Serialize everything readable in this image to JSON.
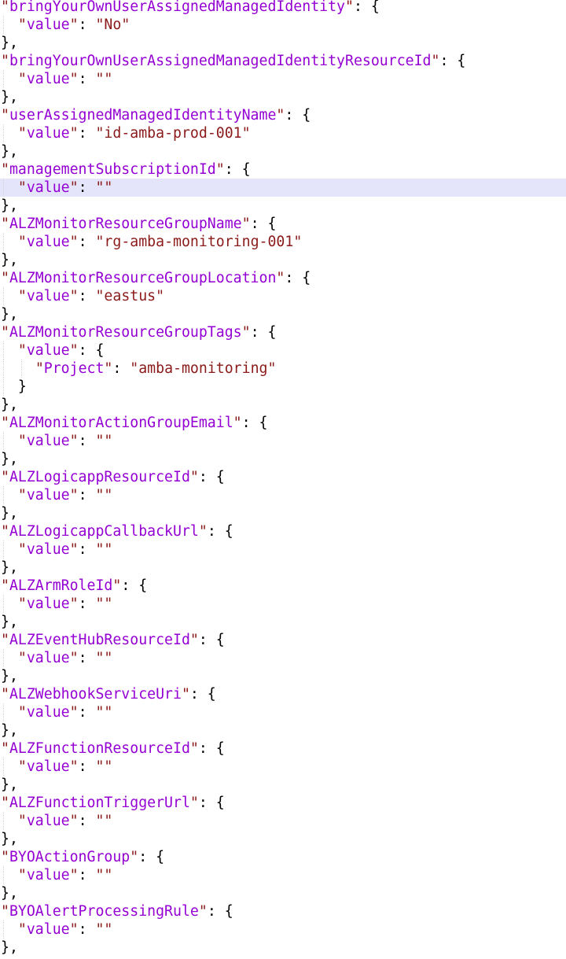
{
  "editor": {
    "language": "json",
    "colors": {
      "background": "#ffffff",
      "key": "#9400d3",
      "quote": "#8b1a1a",
      "string": "#8b1a1a",
      "punctuation": "#000000",
      "current_line_highlight": "#e4e4fb",
      "indent_guide": "#d2d2d2"
    },
    "highlighted_line_index": 10,
    "lines": [
      {
        "indent": 0,
        "text": "\"bringYourOwnUserAssignedManagedIdentity\": {",
        "kind": "key-open"
      },
      {
        "indent": 1,
        "text": "  \"value\": \"No\"",
        "kind": "key-value"
      },
      {
        "indent": 0,
        "text": "},",
        "kind": "close"
      },
      {
        "indent": 0,
        "text": "\"bringYourOwnUserAssignedManagedIdentityResourceId\": {",
        "kind": "key-open"
      },
      {
        "indent": 1,
        "text": "  \"value\": \"\"",
        "kind": "key-value"
      },
      {
        "indent": 0,
        "text": "},",
        "kind": "close"
      },
      {
        "indent": 0,
        "text": "\"userAssignedManagedIdentityName\": {",
        "kind": "key-open"
      },
      {
        "indent": 1,
        "text": "  \"value\": \"id-amba-prod-001\"",
        "kind": "key-value"
      },
      {
        "indent": 0,
        "text": "},",
        "kind": "close"
      },
      {
        "indent": 0,
        "text": "\"managementSubscriptionId\": {",
        "kind": "key-open"
      },
      {
        "indent": 1,
        "text": "  \"value\": \"\"",
        "kind": "key-value"
      },
      {
        "indent": 0,
        "text": "},",
        "kind": "close"
      },
      {
        "indent": 0,
        "text": "\"ALZMonitorResourceGroupName\": {",
        "kind": "key-open"
      },
      {
        "indent": 1,
        "text": "  \"value\": \"rg-amba-monitoring-001\"",
        "kind": "key-value"
      },
      {
        "indent": 0,
        "text": "},",
        "kind": "close"
      },
      {
        "indent": 0,
        "text": "\"ALZMonitorResourceGroupLocation\": {",
        "kind": "key-open"
      },
      {
        "indent": 1,
        "text": "  \"value\": \"eastus\"",
        "kind": "key-value"
      },
      {
        "indent": 0,
        "text": "},",
        "kind": "close"
      },
      {
        "indent": 0,
        "text": "\"ALZMonitorResourceGroupTags\": {",
        "kind": "key-open"
      },
      {
        "indent": 1,
        "text": "  \"value\": {",
        "kind": "key-open"
      },
      {
        "indent": 2,
        "text": "    \"Project\": \"amba-monitoring\"",
        "kind": "key-value"
      },
      {
        "indent": 1,
        "text": "  }",
        "kind": "close"
      },
      {
        "indent": 0,
        "text": "},",
        "kind": "close"
      },
      {
        "indent": 0,
        "text": "\"ALZMonitorActionGroupEmail\": {",
        "kind": "key-open"
      },
      {
        "indent": 1,
        "text": "  \"value\": \"\"",
        "kind": "key-value"
      },
      {
        "indent": 0,
        "text": "},",
        "kind": "close"
      },
      {
        "indent": 0,
        "text": "\"ALZLogicappResourceId\": {",
        "kind": "key-open"
      },
      {
        "indent": 1,
        "text": "  \"value\": \"\"",
        "kind": "key-value"
      },
      {
        "indent": 0,
        "text": "},",
        "kind": "close"
      },
      {
        "indent": 0,
        "text": "\"ALZLogicappCallbackUrl\": {",
        "kind": "key-open"
      },
      {
        "indent": 1,
        "text": "  \"value\": \"\"",
        "kind": "key-value"
      },
      {
        "indent": 0,
        "text": "},",
        "kind": "close"
      },
      {
        "indent": 0,
        "text": "\"ALZArmRoleId\": {",
        "kind": "key-open"
      },
      {
        "indent": 1,
        "text": "  \"value\": \"\"",
        "kind": "key-value"
      },
      {
        "indent": 0,
        "text": "},",
        "kind": "close"
      },
      {
        "indent": 0,
        "text": "\"ALZEventHubResourceId\": {",
        "kind": "key-open"
      },
      {
        "indent": 1,
        "text": "  \"value\": \"\"",
        "kind": "key-value"
      },
      {
        "indent": 0,
        "text": "},",
        "kind": "close"
      },
      {
        "indent": 0,
        "text": "\"ALZWebhookServiceUri\": {",
        "kind": "key-open"
      },
      {
        "indent": 1,
        "text": "  \"value\": \"\"",
        "kind": "key-value"
      },
      {
        "indent": 0,
        "text": "},",
        "kind": "close"
      },
      {
        "indent": 0,
        "text": "\"ALZFunctionResourceId\": {",
        "kind": "key-open"
      },
      {
        "indent": 1,
        "text": "  \"value\": \"\"",
        "kind": "key-value"
      },
      {
        "indent": 0,
        "text": "},",
        "kind": "close"
      },
      {
        "indent": 0,
        "text": "\"ALZFunctionTriggerUrl\": {",
        "kind": "key-open"
      },
      {
        "indent": 1,
        "text": "  \"value\": \"\"",
        "kind": "key-value"
      },
      {
        "indent": 0,
        "text": "},",
        "kind": "close"
      },
      {
        "indent": 0,
        "text": "\"BYOActionGroup\": {",
        "kind": "key-open"
      },
      {
        "indent": 1,
        "text": "  \"value\": \"\"",
        "kind": "key-value"
      },
      {
        "indent": 0,
        "text": "},",
        "kind": "close"
      },
      {
        "indent": 0,
        "text": "\"BYOAlertProcessingRule\": {",
        "kind": "key-open"
      },
      {
        "indent": 1,
        "text": "  \"value\": \"\"",
        "kind": "key-value"
      },
      {
        "indent": 0,
        "text": "},",
        "kind": "close"
      }
    ]
  },
  "parameters": {
    "bringYourOwnUserAssignedManagedIdentity": "No",
    "bringYourOwnUserAssignedManagedIdentityResourceId": "",
    "userAssignedManagedIdentityName": "id-amba-prod-001",
    "managementSubscriptionId": "",
    "ALZMonitorResourceGroupName": "rg-amba-monitoring-001",
    "ALZMonitorResourceGroupLocation": "eastus",
    "ALZMonitorResourceGroupTags": {
      "Project": "amba-monitoring"
    },
    "ALZMonitorActionGroupEmail": "",
    "ALZLogicappResourceId": "",
    "ALZLogicappCallbackUrl": "",
    "ALZArmRoleId": "",
    "ALZEventHubResourceId": "",
    "ALZWebhookServiceUri": "",
    "ALZFunctionResourceId": "",
    "ALZFunctionTriggerUrl": "",
    "BYOActionGroup": "",
    "BYOAlertProcessingRule": ""
  }
}
